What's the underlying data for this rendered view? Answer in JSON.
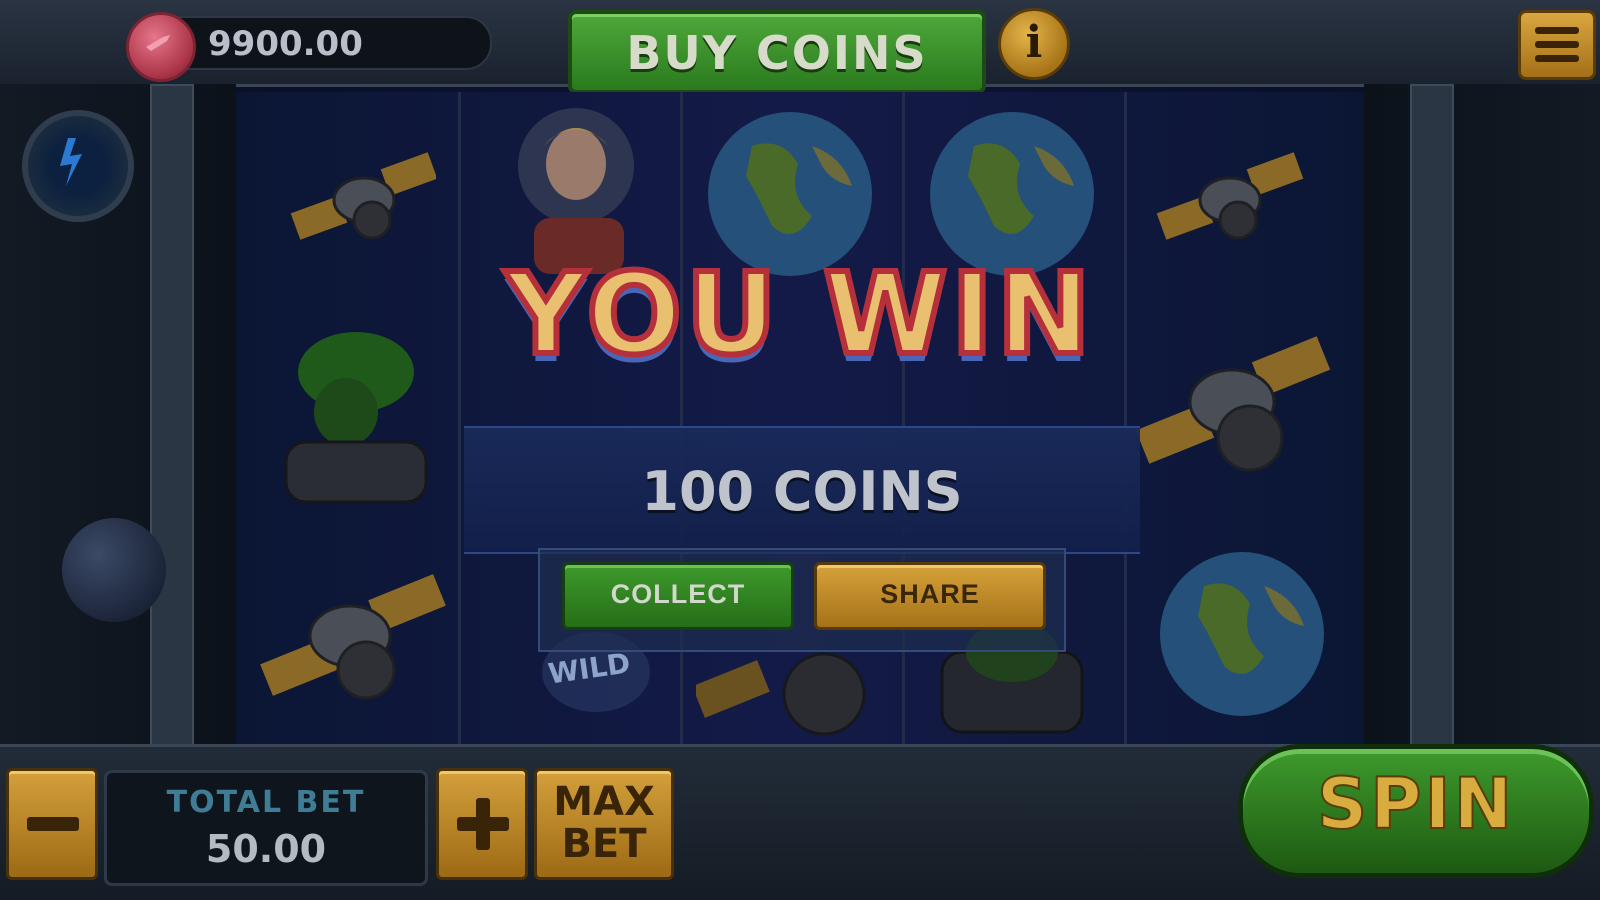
{
  "header": {
    "balance": "9900.00",
    "buy_coins_label": "BUY COINS",
    "info_glyph": "i"
  },
  "win_popup": {
    "title": "YOU WIN",
    "amount": "100 COINS",
    "collect_label": "COLLECT",
    "share_label": "SHARE"
  },
  "reels": {
    "wild_label": "WILD",
    "symbols": [
      "satellite-icon",
      "astronaut-icon",
      "earth-icon",
      "alien-icon"
    ]
  },
  "footer": {
    "total_bet_label": "TOTAL BET",
    "total_bet_value": "50.00",
    "max_bet_label": "MAX\nBET",
    "spin_label": "SPIN"
  },
  "colors": {
    "green_button": "#2a7a1e",
    "gold_button": "#a87418",
    "coin": "#a93246",
    "win_text": "#e8c070"
  }
}
